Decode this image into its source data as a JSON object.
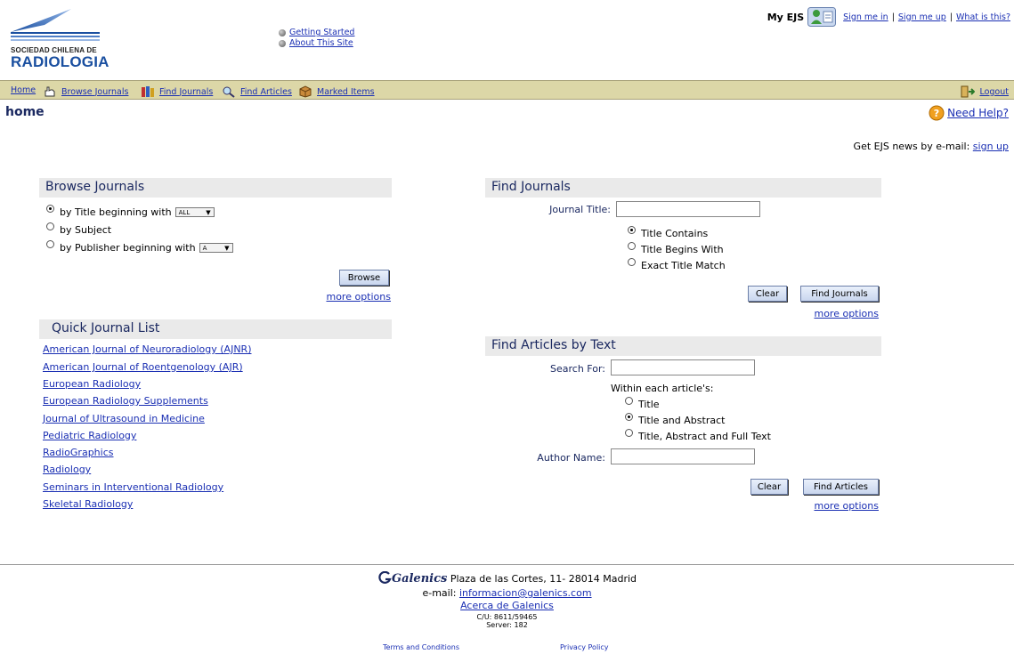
{
  "header": {
    "logo_line1": "SOCIEDAD CHILENA DE",
    "logo_line2": "RADIOLOGIA",
    "links": [
      "Getting Started",
      "About This Site"
    ],
    "myejs_label": "My EJS",
    "account_links": [
      "Sign me in",
      "Sign me up",
      "What is this?"
    ]
  },
  "nav": {
    "items": [
      "Home",
      "Browse Journals",
      "Find Journals",
      "Find Articles",
      "Marked Items"
    ],
    "logout": "Logout"
  },
  "page": {
    "title": "home",
    "need_help": "Need Help?",
    "news_text": "Get EJS news by e-mail:",
    "news_link": "sign up"
  },
  "browse_journals": {
    "heading": "Browse Journals",
    "options": [
      "by Title beginning with",
      "by Subject",
      "by Publisher beginning with"
    ],
    "title_select": "ALL",
    "publisher_select": "A",
    "button": "Browse",
    "more": "more options"
  },
  "quick_list": {
    "heading": "Quick Journal List",
    "journals": [
      "American Journal of Neuroradiology (AJNR)",
      "American Journal of Roentgenology (AJR)",
      "European Radiology",
      "European Radiology Supplements",
      "Journal of Ultrasound in Medicine",
      "Pediatric Radiology",
      "RadioGraphics",
      "Radiology",
      "Seminars in Interventional Radiology",
      "Skeletal Radiology"
    ]
  },
  "find_journals": {
    "heading": "Find Journals",
    "label": "Journal Title:",
    "options": [
      "Title Contains",
      "Title Begins With",
      "Exact Title Match"
    ],
    "clear": "Clear",
    "submit": "Find Journals",
    "more": "more options"
  },
  "find_articles": {
    "heading": "Find Articles by Text",
    "search_label": "Search For:",
    "within_label": "Within each article's:",
    "options": [
      "Title",
      "Title and Abstract",
      "Title, Abstract and Full Text"
    ],
    "author_label": "Author Name:",
    "clear": "Clear",
    "submit": "Find Articles",
    "more": "more options"
  },
  "footer": {
    "brand": "Galenics",
    "address": "Plaza de las Cortes, 11- 28014 Madrid",
    "email_label": "e-mail:",
    "email": "informacion@galenics.com",
    "about": "Acerca de Galenics",
    "cu": "C/U: 8611/59465",
    "server": "Server: 182",
    "terms": "Terms and Conditions",
    "privacy": "Privacy Policy"
  }
}
